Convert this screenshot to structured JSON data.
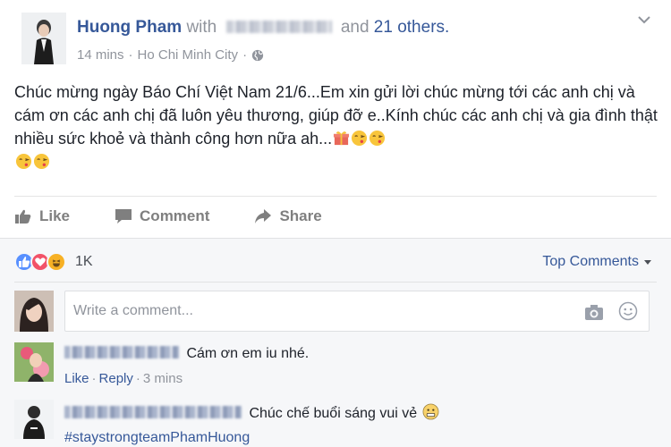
{
  "post": {
    "author": "Huong Pham",
    "with_word": "with",
    "and_word": "and",
    "others": "21 others.",
    "time": "14 mins",
    "sep": "·",
    "location": "Ho Chi Minh City",
    "text": "Chúc mừng ngày Báo Chí Việt Nam 21/6...Em xin gửi lời chúc mừng tới các anh chị và cám ơn các anh chị đã luôn yêu thương, giúp đỡ e..Kính chúc các anh chị và gia đình thật nhiều sức khoẻ và thành công hơn nữa ah...",
    "actions": {
      "like": "Like",
      "comment": "Comment",
      "share": "Share"
    }
  },
  "reactions": {
    "count": "1K",
    "top_comments": "Top Comments"
  },
  "composer": {
    "placeholder": "Write a comment..."
  },
  "comments": [
    {
      "text": "Cám ơn em iu nhé.",
      "like": "Like",
      "reply": "Reply",
      "sep": "·",
      "time": "3 mins"
    },
    {
      "text": "Chúc chế buổi sáng vui vẻ",
      "hashtag": "#staystrongteamPhamHuong"
    }
  ],
  "colors": {
    "link": "#365899",
    "muted": "#90949c",
    "text": "#1d2129",
    "like_blue": "#5890ff",
    "love_red": "#f25268",
    "haha_yellow": "#f7b125"
  }
}
